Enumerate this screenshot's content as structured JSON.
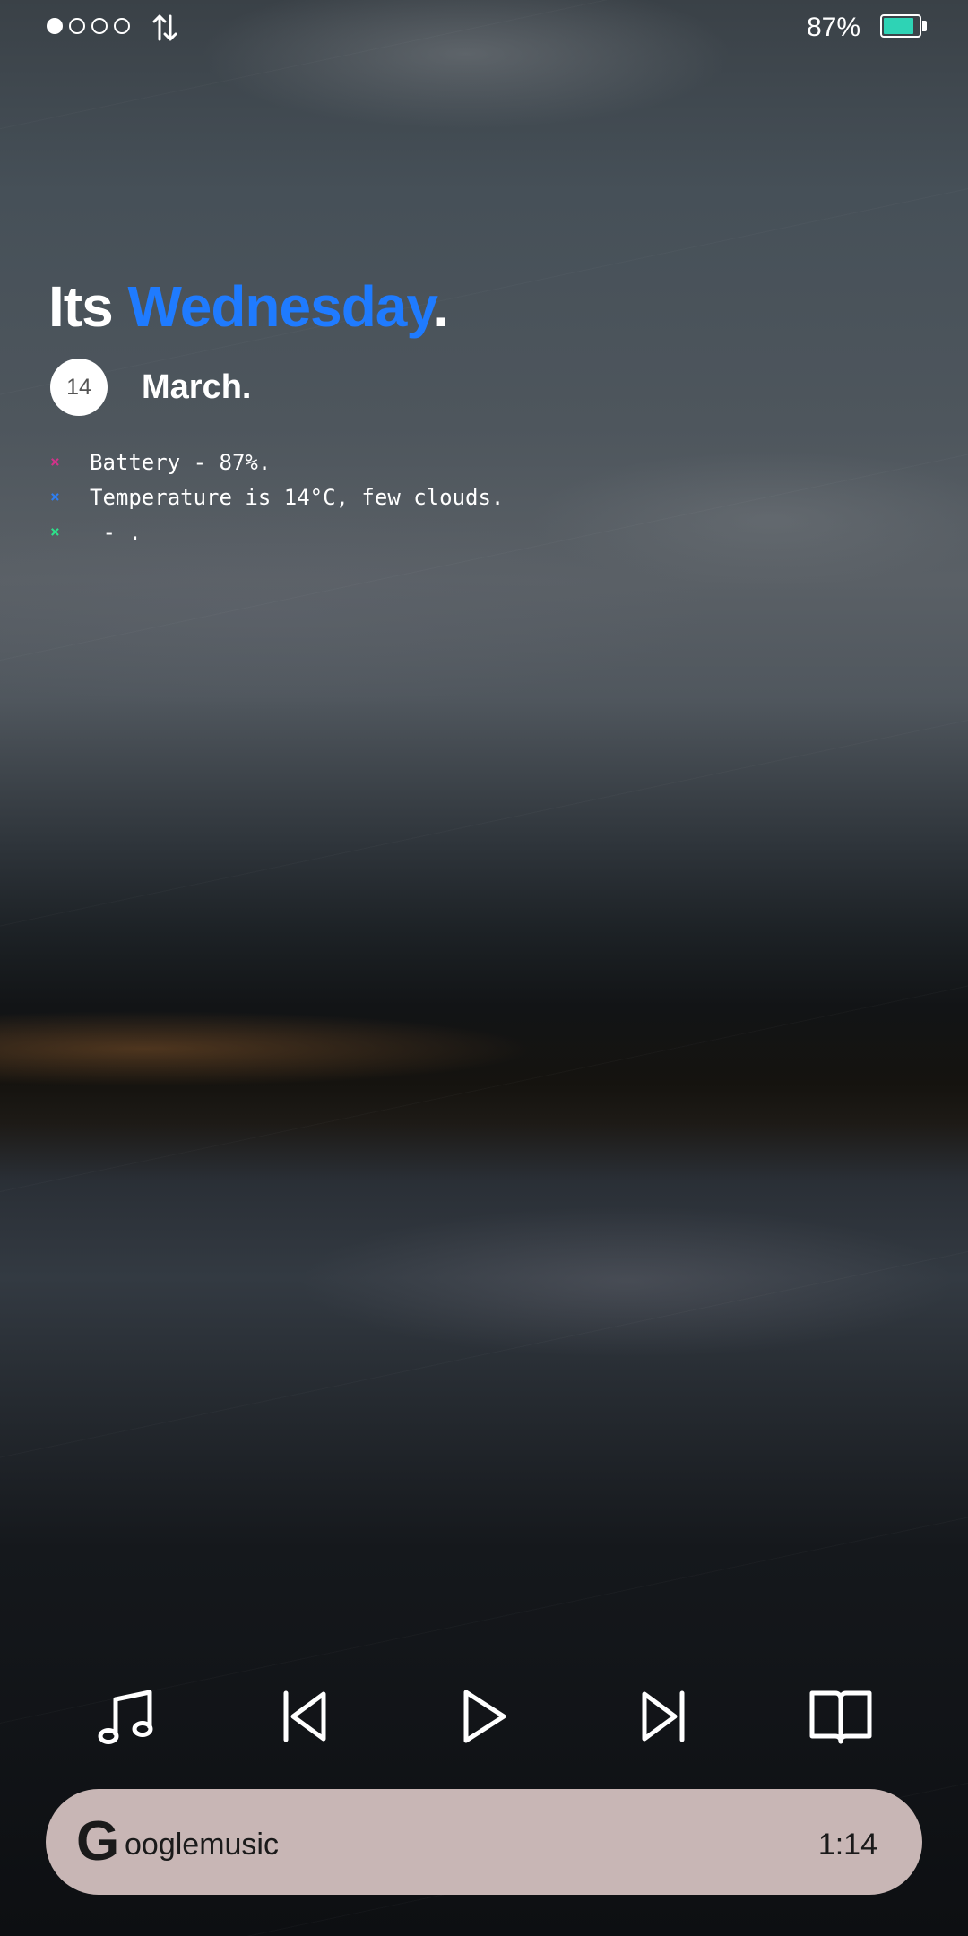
{
  "status_bar": {
    "battery_percent_label": "87%",
    "battery_level": 0.87,
    "battery_color": "#2ed3b5",
    "signal_strength": 1,
    "signal_max": 4,
    "data_icon": "data-transfer-arrows-icon"
  },
  "widget": {
    "greeting_prefix": "Its ",
    "day_name": "Wednesday",
    "greeting_suffix": ".",
    "day_color": "#1f7bff",
    "date_number": "14",
    "month": "March.",
    "info_items": [
      {
        "mark": "×",
        "mark_color": "#d0338a",
        "text": "Battery - 87%."
      },
      {
        "mark": "×",
        "mark_color": "#2f7ef0",
        "text": "Temperature is 14°C, few clouds."
      },
      {
        "mark": "×",
        "mark_color": "#2ee08a",
        "text": " - ."
      }
    ]
  },
  "media_controls": {
    "icons": [
      "music-note-icon",
      "skip-previous-icon",
      "play-icon",
      "skip-next-icon",
      "book-icon"
    ]
  },
  "player": {
    "logo_letter": "G",
    "title": "ooglemusic",
    "time": "1:14",
    "background_color": "#c8b6b5"
  }
}
